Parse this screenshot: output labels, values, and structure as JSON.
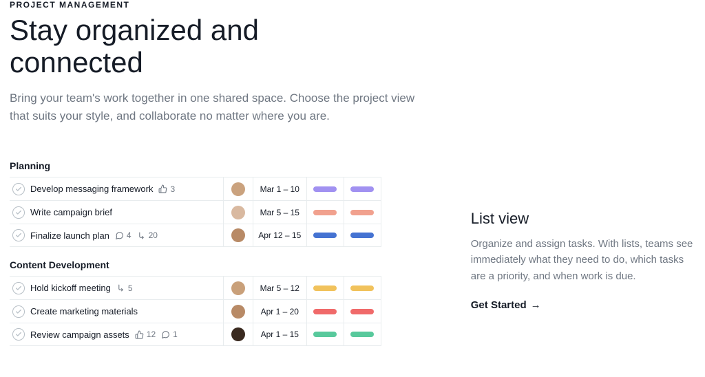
{
  "eyebrow": "PROJECT MANAGEMENT",
  "hero_title": "Stay organized and connected",
  "lead": "Bring your team's work together in one shared space. Choose the project view that suits your style, and collaborate no matter where you are.",
  "colors": {
    "purple": "#a191f1",
    "coral": "#f1a18e",
    "blue": "#4573d2",
    "yellow": "#f1c25c",
    "red": "#f06a6a",
    "green": "#58c99c"
  },
  "sections": [
    {
      "title": "Planning",
      "rows": [
        {
          "name": "Develop messaging framework",
          "likes": 3,
          "comments": null,
          "subtasks": null,
          "date": "Mar 1 – 10",
          "pill_color": "purple",
          "avatar": "#caa27e"
        },
        {
          "name": "Write campaign brief",
          "likes": null,
          "comments": null,
          "subtasks": null,
          "date": "Mar 5 – 15",
          "pill_color": "coral",
          "avatar": "#d9b9a0"
        },
        {
          "name": "Finalize launch plan",
          "likes": null,
          "comments": 4,
          "subtasks": 20,
          "date": "Apr 12 – 15",
          "pill_color": "blue",
          "avatar": "#b88a66"
        }
      ]
    },
    {
      "title": "Content Development",
      "rows": [
        {
          "name": "Hold kickoff meeting",
          "likes": null,
          "comments": null,
          "subtasks": 5,
          "date": "Mar 5 – 12",
          "pill_color": "yellow",
          "avatar": "#c9a07a"
        },
        {
          "name": "Create marketing materials",
          "likes": null,
          "comments": null,
          "subtasks": null,
          "date": "Apr 1 – 20",
          "pill_color": "red",
          "avatar": "#b88a66"
        },
        {
          "name": "Review campaign assets",
          "likes": 12,
          "comments": 1,
          "subtasks": null,
          "date": "Apr 1 – 15",
          "pill_color": "green",
          "avatar": "#3a2a20"
        }
      ]
    }
  ],
  "side": {
    "title": "List view",
    "body": "Organize and assign tasks. With lists, teams see immediately what they need to do, which tasks are a priority, and when work is due.",
    "cta": "Get Started"
  }
}
